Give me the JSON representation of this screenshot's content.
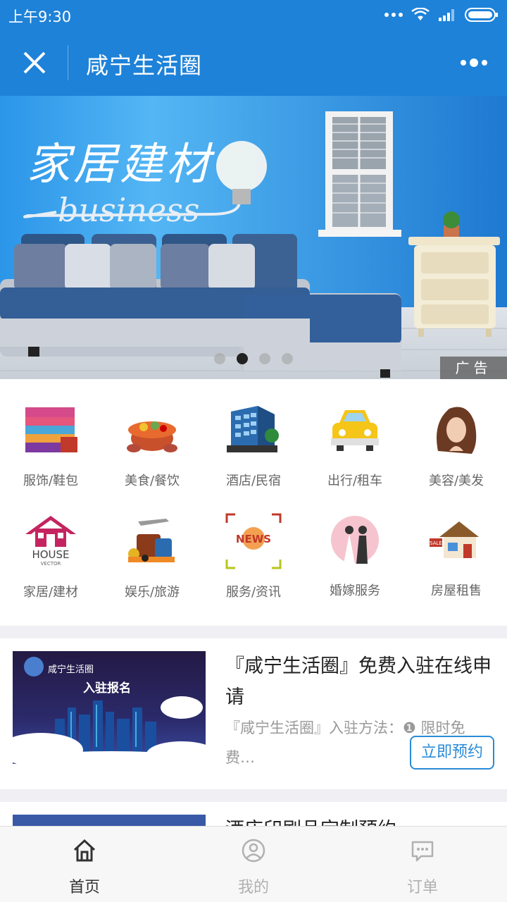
{
  "status_bar": {
    "time": "上午9:30"
  },
  "titlebar": {
    "title": "咸宁生活圈"
  },
  "banner": {
    "ad_label": "广告",
    "headline": "家居建材",
    "subline": "business",
    "slide_count": 4,
    "active_slide": 2
  },
  "categories": [
    {
      "label": "服饰/鞋包",
      "icon": "clothing-icon"
    },
    {
      "label": "美食/餐饮",
      "icon": "food-icon"
    },
    {
      "label": "酒店/民宿",
      "icon": "hotel-icon"
    },
    {
      "label": "出行/租车",
      "icon": "taxi-icon"
    },
    {
      "label": "美容/美发",
      "icon": "beauty-icon"
    },
    {
      "label": "家居/建材",
      "icon": "house-icon",
      "icon_text_1": "HOUSE",
      "icon_text_2": "VECTOR"
    },
    {
      "label": "娱乐/旅游",
      "icon": "travel-icon"
    },
    {
      "label": "服务/资讯",
      "icon": "news-icon",
      "icon_text": "NEWS"
    },
    {
      "label": "婚嫁服务",
      "icon": "wedding-icon"
    },
    {
      "label": "房屋租售",
      "icon": "home-sale-icon",
      "icon_text": "SALE"
    }
  ],
  "articles": [
    {
      "title": "『咸宁生活圈』免费入驻在线申请",
      "desc": "『咸宁生活圈』入驻方法：❶ 限时免费…",
      "thumb_brand": "咸宁生活圈",
      "thumb_text": "入驻报名",
      "button": "立即预约"
    },
    {
      "title": "酒店印刷品定制预约"
    }
  ],
  "tabbar": [
    {
      "label": "首页",
      "icon": "home-icon",
      "active": true
    },
    {
      "label": "我的",
      "icon": "user-icon",
      "active": false
    },
    {
      "label": "订单",
      "icon": "message-icon",
      "active": false
    }
  ],
  "colors": {
    "brand_blue": "#1e82d8",
    "button_blue": "#2a8bd7"
  }
}
